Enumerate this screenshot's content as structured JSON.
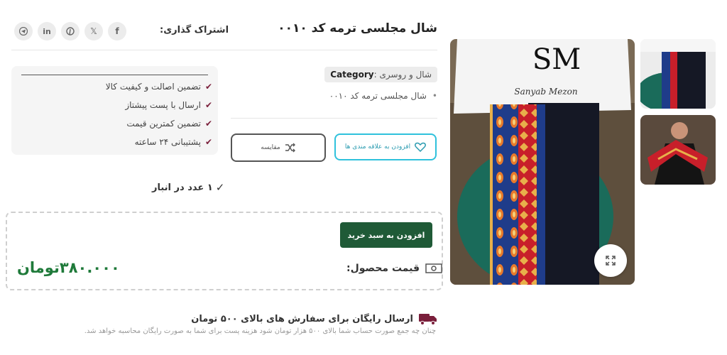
{
  "product": {
    "title": "شال مجلسی ترمه کد ۰۰۱۰",
    "category_label": "Category",
    "category_value": "شال و روسری",
    "meta_item": "شال مجلسی ترمه کد ۰۰۱۰"
  },
  "share": {
    "label": "اشتراک گذاری:",
    "icons": [
      "facebook-icon",
      "x-icon",
      "pinterest-icon",
      "linkedin-icon",
      "telegram-icon"
    ]
  },
  "gallery": {
    "logo_text": "SM",
    "brand_text": "Sanyab Mezon"
  },
  "actions": {
    "wishlist_label": "افزودن به علاقه مندی ها",
    "compare_label": "مقایسه"
  },
  "guarantees": [
    "تضمین اصالت و کیفیت کالا",
    "ارسال با پست پیشتاز",
    "تضمین کمترین قیمت",
    "پشتیبانی ۲۴ ساعته"
  ],
  "stock": {
    "text": "۱ عدد در انبار"
  },
  "purchase": {
    "cart_button": "افزودن به سبد خرید",
    "price_label": "قیمت محصول:",
    "price_value": "۳۸۰.۰۰۰تومان"
  },
  "shipping": {
    "title": "ارسال رایگان برای سفارش های بالای ۵۰۰ تومان",
    "description": "چنان چه جمع صورت حساب شما بالای ۵۰۰ هزار تومان شود هزینه پست برای شما به صورت رایگان محاسبه خواهد شد."
  },
  "colors": {
    "accent_dark_green": "#1f5a37",
    "price_green": "#1f7a3a",
    "wishlist_cyan": "#2fc1dc",
    "check_maroon": "#7a1f3b"
  }
}
